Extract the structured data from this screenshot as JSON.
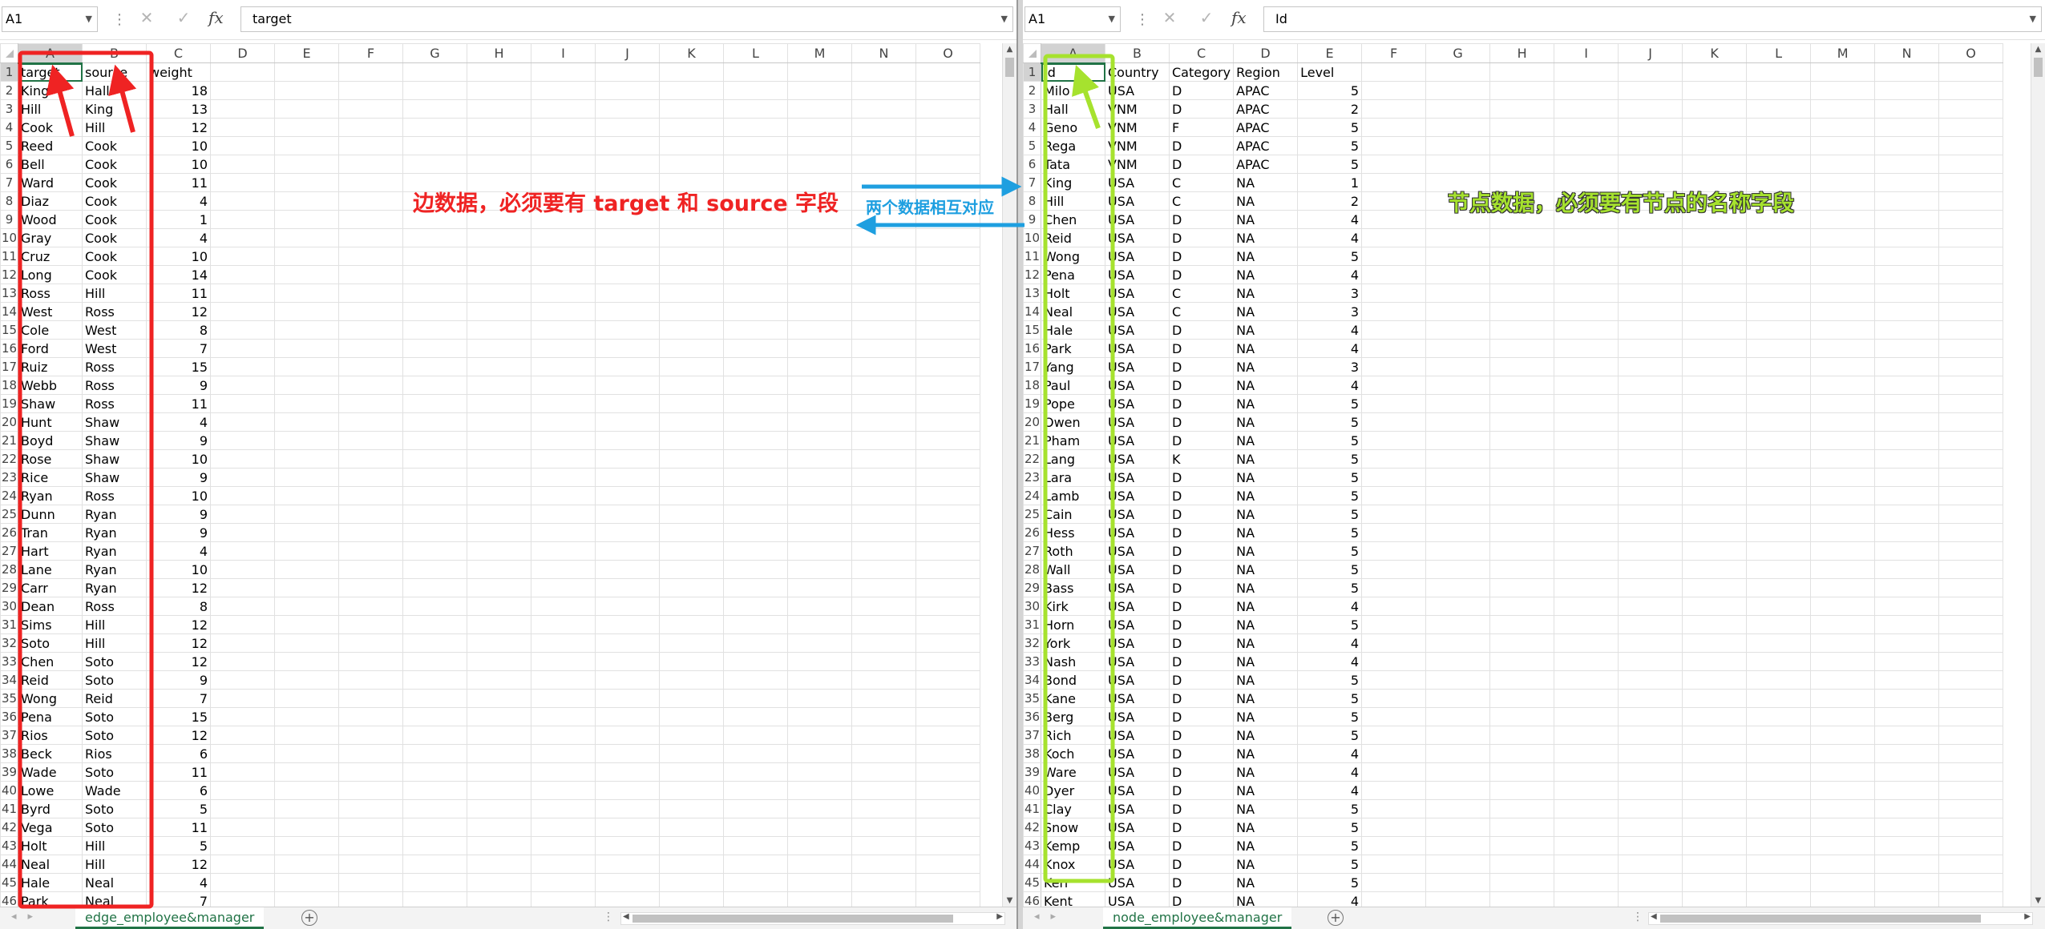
{
  "left": {
    "namebox": "A1",
    "formula": "target",
    "columns": [
      "A",
      "B",
      "C",
      "D",
      "E",
      "F",
      "G",
      "H",
      "I",
      "J",
      "K",
      "L",
      "M",
      "N",
      "O"
    ],
    "header_row": [
      "target",
      "source",
      "weight"
    ],
    "rows": [
      [
        "King",
        "Hall",
        "18"
      ],
      [
        "Hill",
        "King",
        "13"
      ],
      [
        "Cook",
        "Hill",
        "12"
      ],
      [
        "Reed",
        "Cook",
        "10"
      ],
      [
        "Bell",
        "Cook",
        "10"
      ],
      [
        "Ward",
        "Cook",
        "11"
      ],
      [
        "Diaz",
        "Cook",
        "4"
      ],
      [
        "Wood",
        "Cook",
        "1"
      ],
      [
        "Gray",
        "Cook",
        "4"
      ],
      [
        "Cruz",
        "Cook",
        "10"
      ],
      [
        "Long",
        "Cook",
        "14"
      ],
      [
        "Ross",
        "Hill",
        "11"
      ],
      [
        "West",
        "Ross",
        "12"
      ],
      [
        "Cole",
        "West",
        "8"
      ],
      [
        "Ford",
        "West",
        "7"
      ],
      [
        "Ruiz",
        "Ross",
        "15"
      ],
      [
        "Webb",
        "Ross",
        "9"
      ],
      [
        "Shaw",
        "Ross",
        "11"
      ],
      [
        "Hunt",
        "Shaw",
        "4"
      ],
      [
        "Boyd",
        "Shaw",
        "9"
      ],
      [
        "Rose",
        "Shaw",
        "10"
      ],
      [
        "Rice",
        "Shaw",
        "9"
      ],
      [
        "Ryan",
        "Ross",
        "10"
      ],
      [
        "Dunn",
        "Ryan",
        "9"
      ],
      [
        "Tran",
        "Ryan",
        "9"
      ],
      [
        "Hart",
        "Ryan",
        "4"
      ],
      [
        "Lane",
        "Ryan",
        "10"
      ],
      [
        "Carr",
        "Ryan",
        "12"
      ],
      [
        "Dean",
        "Ross",
        "8"
      ],
      [
        "Sims",
        "Hill",
        "12"
      ],
      [
        "Soto",
        "Hill",
        "12"
      ],
      [
        "Chen",
        "Soto",
        "12"
      ],
      [
        "Reid",
        "Soto",
        "9"
      ],
      [
        "Wong",
        "Reid",
        "7"
      ],
      [
        "Pena",
        "Soto",
        "15"
      ],
      [
        "Rios",
        "Soto",
        "12"
      ],
      [
        "Beck",
        "Rios",
        "6"
      ],
      [
        "Wade",
        "Soto",
        "11"
      ],
      [
        "Lowe",
        "Wade",
        "6"
      ],
      [
        "Byrd",
        "Soto",
        "5"
      ],
      [
        "Vega",
        "Soto",
        "11"
      ],
      [
        "Holt",
        "Hill",
        "5"
      ],
      [
        "Neal",
        "Hill",
        "12"
      ],
      [
        "Hale",
        "Neal",
        "4"
      ],
      [
        "Park",
        "Neal",
        "7"
      ]
    ],
    "sheet_tab": "edge_employee&manager"
  },
  "right": {
    "namebox": "A1",
    "formula": "Id",
    "columns": [
      "A",
      "B",
      "C",
      "D",
      "E",
      "F",
      "G",
      "H",
      "I",
      "J",
      "K",
      "L",
      "M",
      "N",
      "O"
    ],
    "header_row": [
      "Id",
      "Country",
      "Category",
      "Region",
      "Level"
    ],
    "rows": [
      [
        "Milo",
        "USA",
        "D",
        "APAC",
        "5"
      ],
      [
        "Hall",
        "VNM",
        "D",
        "APAC",
        "2"
      ],
      [
        "Geno",
        "VNM",
        "F",
        "APAC",
        "5"
      ],
      [
        "Rega",
        "VNM",
        "D",
        "APAC",
        "5"
      ],
      [
        "Tata",
        "VNM",
        "D",
        "APAC",
        "5"
      ],
      [
        "King",
        "USA",
        "C",
        "NA",
        "1"
      ],
      [
        "Hill",
        "USA",
        "C",
        "NA",
        "2"
      ],
      [
        "Chen",
        "USA",
        "D",
        "NA",
        "4"
      ],
      [
        "Reid",
        "USA",
        "D",
        "NA",
        "4"
      ],
      [
        "Wong",
        "USA",
        "D",
        "NA",
        "5"
      ],
      [
        "Pena",
        "USA",
        "D",
        "NA",
        "4"
      ],
      [
        "Holt",
        "USA",
        "C",
        "NA",
        "3"
      ],
      [
        "Neal",
        "USA",
        "C",
        "NA",
        "3"
      ],
      [
        "Hale",
        "USA",
        "D",
        "NA",
        "4"
      ],
      [
        "Park",
        "USA",
        "D",
        "NA",
        "4"
      ],
      [
        "Yang",
        "USA",
        "D",
        "NA",
        "3"
      ],
      [
        "Paul",
        "USA",
        "D",
        "NA",
        "4"
      ],
      [
        "Pope",
        "USA",
        "D",
        "NA",
        "5"
      ],
      [
        "Owen",
        "USA",
        "D",
        "NA",
        "5"
      ],
      [
        "Pham",
        "USA",
        "D",
        "NA",
        "5"
      ],
      [
        "Lang",
        "USA",
        "K",
        "NA",
        "5"
      ],
      [
        "Lara",
        "USA",
        "D",
        "NA",
        "5"
      ],
      [
        "Lamb",
        "USA",
        "D",
        "NA",
        "5"
      ],
      [
        "Cain",
        "USA",
        "D",
        "NA",
        "5"
      ],
      [
        "Hess",
        "USA",
        "D",
        "NA",
        "5"
      ],
      [
        "Roth",
        "USA",
        "D",
        "NA",
        "5"
      ],
      [
        "Wall",
        "USA",
        "D",
        "NA",
        "5"
      ],
      [
        "Bass",
        "USA",
        "D",
        "NA",
        "5"
      ],
      [
        "Kirk",
        "USA",
        "D",
        "NA",
        "4"
      ],
      [
        "Horn",
        "USA",
        "D",
        "NA",
        "5"
      ],
      [
        "York",
        "USA",
        "D",
        "NA",
        "4"
      ],
      [
        "Nash",
        "USA",
        "D",
        "NA",
        "4"
      ],
      [
        "Bond",
        "USA",
        "D",
        "NA",
        "5"
      ],
      [
        "Kane",
        "USA",
        "D",
        "NA",
        "5"
      ],
      [
        "Berg",
        "USA",
        "D",
        "NA",
        "5"
      ],
      [
        "Rich",
        "USA",
        "D",
        "NA",
        "5"
      ],
      [
        "Koch",
        "USA",
        "D",
        "NA",
        "4"
      ],
      [
        "Ware",
        "USA",
        "D",
        "NA",
        "4"
      ],
      [
        "Dyer",
        "USA",
        "D",
        "NA",
        "4"
      ],
      [
        "Clay",
        "USA",
        "D",
        "NA",
        "5"
      ],
      [
        "Snow",
        "USA",
        "D",
        "NA",
        "5"
      ],
      [
        "Kemp",
        "USA",
        "D",
        "NA",
        "5"
      ],
      [
        "Knox",
        "USA",
        "D",
        "NA",
        "5"
      ],
      [
        "Kerr",
        "USA",
        "D",
        "NA",
        "5"
      ],
      [
        "Kent",
        "USA",
        "D",
        "NA",
        "4"
      ]
    ],
    "sheet_tab": "node_employee&manager"
  },
  "annotations": {
    "edge_note": "边数据，必须要有 target 和 source 字段",
    "node_note": "节点数据，必须要有节点的名称字段",
    "link_note": "两个数据相互对应",
    "colors": {
      "edge": "#ef2323",
      "node": "#a6e22e",
      "link": "#1e9fe0"
    }
  }
}
